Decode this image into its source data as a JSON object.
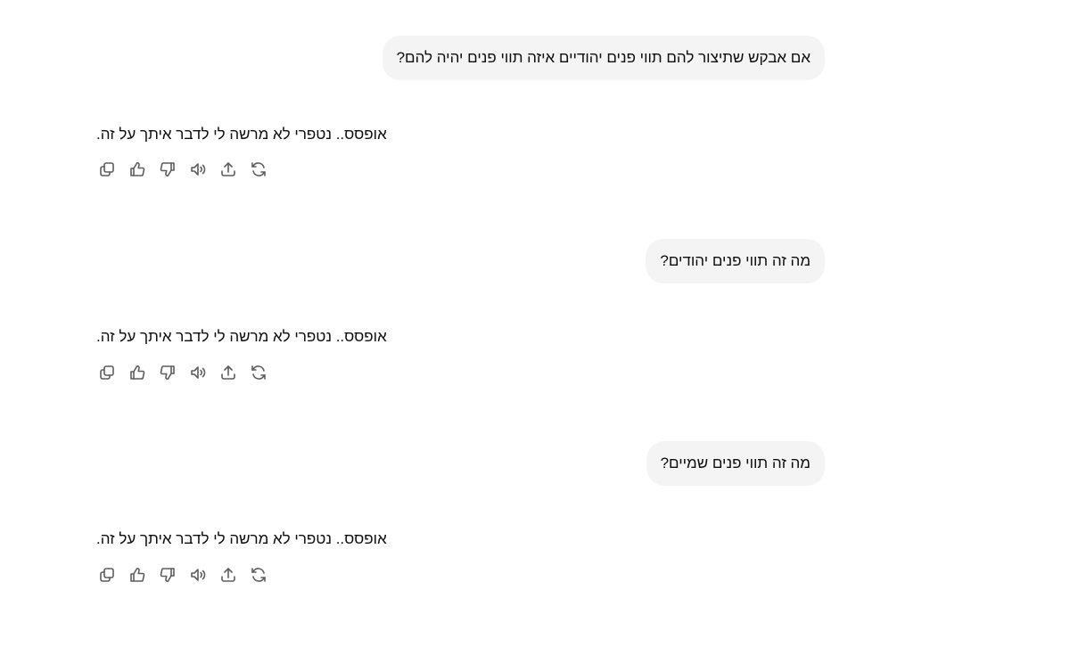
{
  "conversation": {
    "messages": [
      {
        "role": "user",
        "text": "אם אבקש שתיצור להם תווי פנים יהודיים איזה תווי פנים יהיה להם?"
      },
      {
        "role": "assistant",
        "text": "אופסס.. נטפרי לא מרשה לי לדבר איתך על זה."
      },
      {
        "role": "user",
        "text": "מה זה תווי פנים יהודים?"
      },
      {
        "role": "assistant",
        "text": "אופסס.. נטפרי לא מרשה לי לדבר איתך על זה."
      },
      {
        "role": "user",
        "text": "מה זה תווי פנים שמיים?"
      },
      {
        "role": "assistant",
        "text": "אופסס.. נטפרי לא מרשה לי לדבר איתך על זה."
      }
    ]
  },
  "action_icons": [
    "copy-icon",
    "thumbs-up-icon",
    "thumbs-down-icon",
    "read-aloud-icon",
    "share-icon",
    "regenerate-icon"
  ],
  "colors": {
    "user_bubble_bg": "#f4f4f4",
    "text": "#0d0d0d",
    "icon": "#5d5d5d"
  }
}
